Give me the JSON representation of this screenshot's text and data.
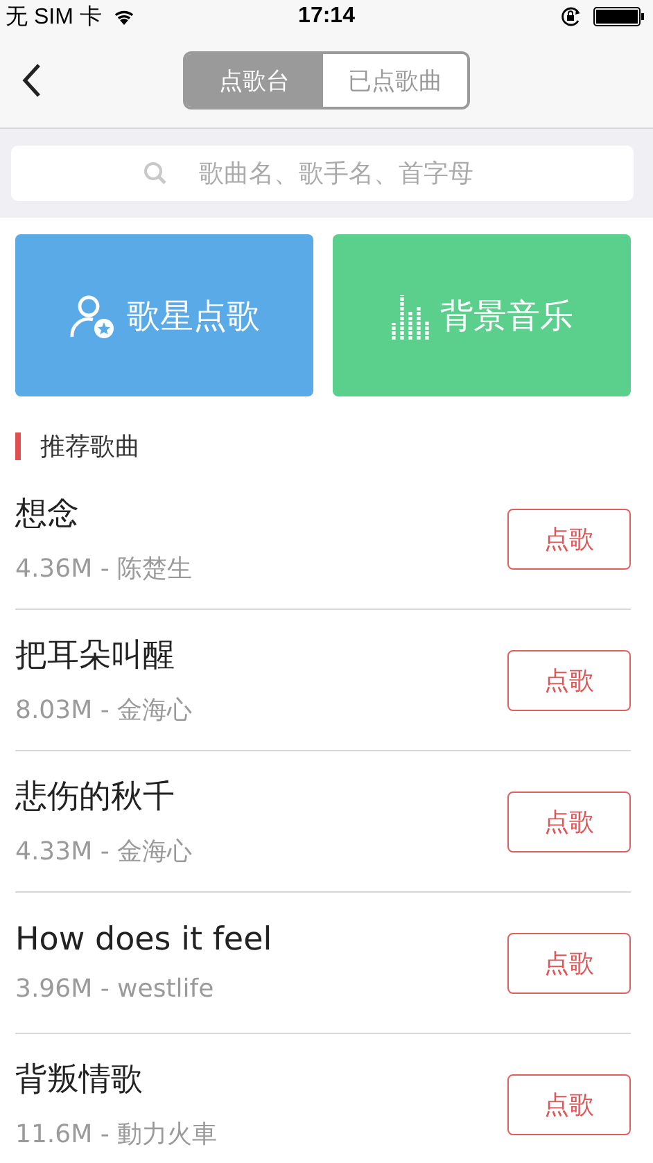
{
  "status_bar": {
    "carrier": "无 SIM 卡",
    "time": "17:14"
  },
  "nav": {
    "tabs": [
      {
        "label": "点歌台",
        "selected": true
      },
      {
        "label": "已点歌曲",
        "selected": false
      }
    ]
  },
  "search": {
    "placeholder": "歌曲名、歌手名、首字母"
  },
  "tiles": [
    {
      "kind": "singer",
      "label": "歌星点歌",
      "color": "#5aaae8"
    },
    {
      "kind": "music",
      "label": "背景音乐",
      "color": "#5ad08c"
    }
  ],
  "section_title": "推荐歌曲",
  "songs": [
    {
      "title": "想念",
      "info": "4.36M - 陈楚生",
      "button": "点歌"
    },
    {
      "title": "把耳朵叫醒",
      "info": "8.03M - 金海心",
      "button": "点歌"
    },
    {
      "title": "悲伤的秋千",
      "info": "4.33M - 金海心",
      "button": "点歌"
    },
    {
      "title": "How does it feel",
      "info": "3.96M - westlife",
      "button": "点歌"
    },
    {
      "title": "背叛情歌",
      "info": "11.6M - 動力火車",
      "button": "点歌"
    }
  ]
}
